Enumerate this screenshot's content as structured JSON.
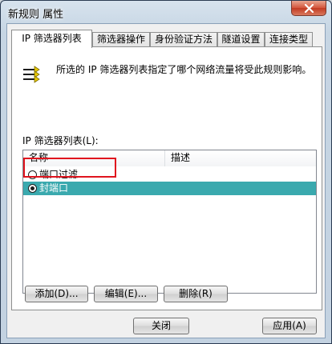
{
  "window": {
    "title": "新规则 属性"
  },
  "tabs": [
    {
      "label": "IP 筛选器列表",
      "active": true
    },
    {
      "label": "筛选器操作",
      "active": false
    },
    {
      "label": "身份验证方法",
      "active": false
    },
    {
      "label": "隧道设置",
      "active": false
    },
    {
      "label": "连接类型",
      "active": false
    }
  ],
  "panel": {
    "description": "所选的 IP 筛选器列表指定了哪个网络流量将受此规则影响。",
    "list_label": "IP 筛选器列表(L):",
    "columns": [
      "名称",
      "描述"
    ],
    "rows": [
      {
        "name": "端口过滤",
        "description": "",
        "selected": false
      },
      {
        "name": "封端口",
        "description": "",
        "selected": true
      }
    ]
  },
  "buttons": {
    "add": "添加(D)...",
    "edit": "编辑(E)...",
    "delete": "删除(R)",
    "close": "关闭",
    "apply": "应用(A)"
  },
  "colors": {
    "selection": "#3aa9ae",
    "highlight_box": "#e0141e"
  }
}
